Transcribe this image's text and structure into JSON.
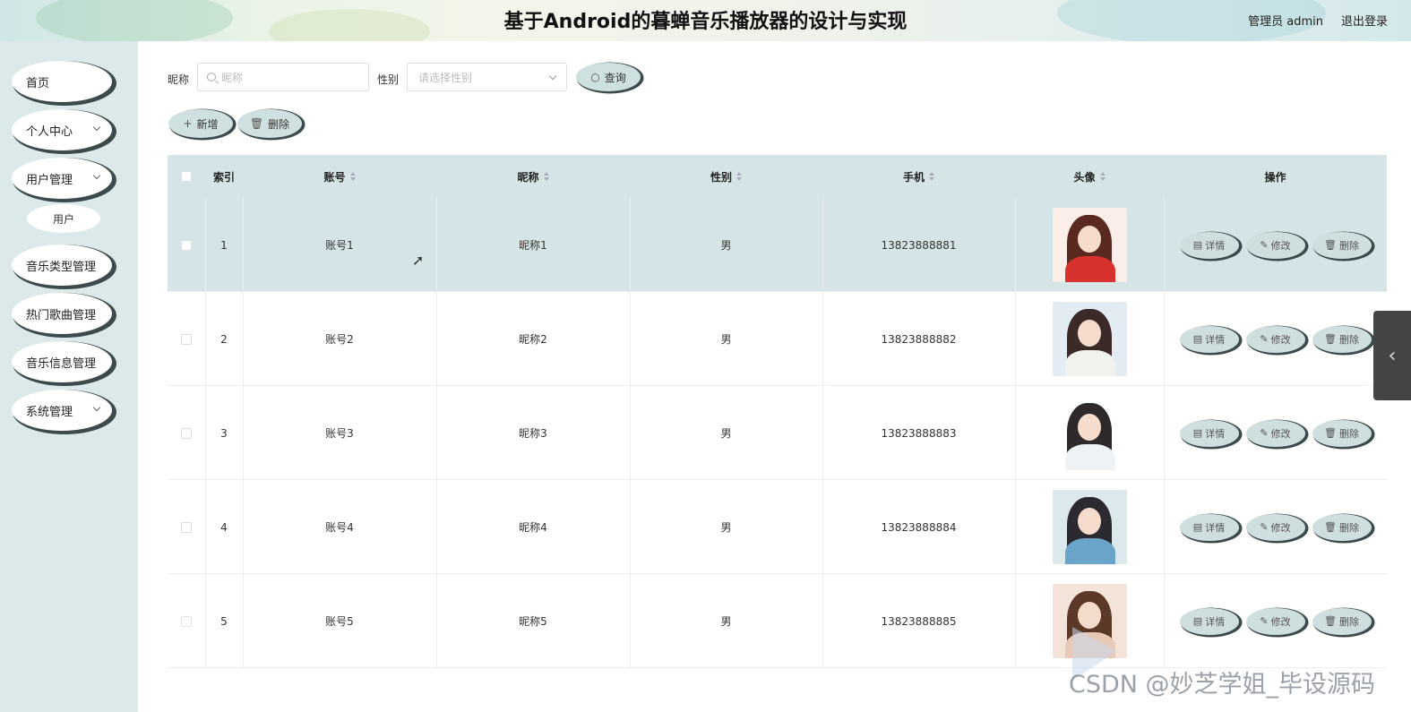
{
  "header": {
    "title": "基于Android的暮蝉音乐播放器的设计与实现",
    "admin_label": "管理员 admin",
    "logout_label": "退出登录"
  },
  "sidebar": {
    "items": [
      {
        "label": "首页",
        "has_children": false
      },
      {
        "label": "个人中心",
        "has_children": true
      },
      {
        "label": "用户管理",
        "has_children": true
      },
      {
        "label": "音乐类型管理",
        "has_children": false
      },
      {
        "label": "热门歌曲管理",
        "has_children": false
      },
      {
        "label": "音乐信息管理",
        "has_children": false
      },
      {
        "label": "系统管理",
        "has_children": true
      }
    ],
    "sub_item": "用户"
  },
  "filters": {
    "nickname_label": "昵称",
    "nickname_placeholder": "昵称",
    "gender_label": "性别",
    "gender_placeholder": "请选择性别",
    "search_button": "查询"
  },
  "actions": {
    "add_button": "新增",
    "delete_button": "删除"
  },
  "table": {
    "columns": [
      "索引",
      "账号",
      "昵称",
      "性别",
      "手机",
      "头像",
      "操作"
    ],
    "rows": [
      {
        "index": "1",
        "account": "账号1",
        "nickname": "昵称1",
        "gender": "男",
        "phone": "13823888881"
      },
      {
        "index": "2",
        "account": "账号2",
        "nickname": "昵称2",
        "gender": "男",
        "phone": "13823888882"
      },
      {
        "index": "3",
        "account": "账号3",
        "nickname": "昵称3",
        "gender": "男",
        "phone": "13823888883"
      },
      {
        "index": "4",
        "account": "账号4",
        "nickname": "昵称4",
        "gender": "男",
        "phone": "13823888884"
      },
      {
        "index": "5",
        "account": "账号5",
        "nickname": "昵称5",
        "gender": "男",
        "phone": "13823888885"
      }
    ],
    "row_ops": {
      "detail": "详情",
      "edit": "修改",
      "delete": "删除"
    }
  },
  "watermark": "CSDN @妙芝学姐_毕设源码",
  "colors": {
    "sidebar_bg": "#dbe9ea",
    "header_row_bg": "#d5e5e7",
    "button_bg": "#cfe0e0",
    "button_shadow": "#3b4a4c"
  }
}
